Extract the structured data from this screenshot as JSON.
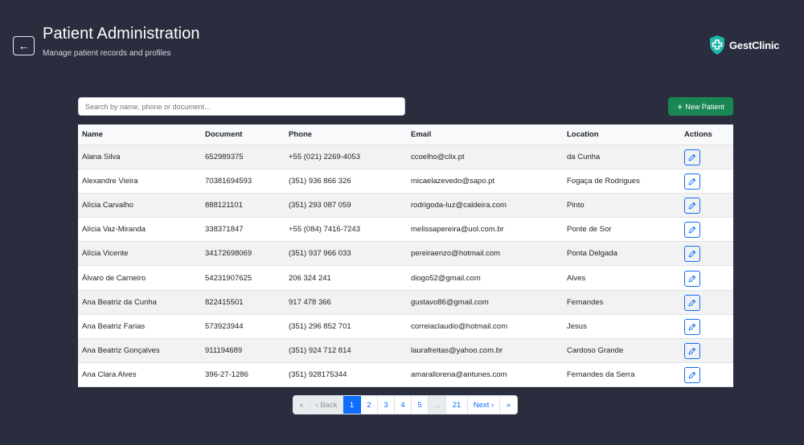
{
  "header": {
    "title": "Patient Administration",
    "subtitle": "Manage patient records and profiles",
    "back_icon": "←",
    "brand_name": "GestClinic"
  },
  "toolbar": {
    "search_placeholder": "Search by name, phone or document...",
    "new_patient_label": "New Patient",
    "new_patient_icon": "+"
  },
  "table": {
    "columns": [
      "Name",
      "Document",
      "Phone",
      "Email",
      "Location",
      "Actions"
    ],
    "rows": [
      {
        "name": "Alana Silva",
        "document": "652989375",
        "phone": "+55 (021) 2269-4053",
        "email": "ccoelho@clix.pt",
        "location": "da Cunha"
      },
      {
        "name": "Alexandre Vieira",
        "document": "70381694593",
        "phone": "(351) 936 866 326",
        "email": "micaelazevedo@sapo.pt",
        "location": "Fogaça de Rodrigues"
      },
      {
        "name": "Alícia Carvalho",
        "document": "888121101",
        "phone": "(351) 293 087 059",
        "email": "rodrigoda-luz@caldeira.com",
        "location": "Pinto"
      },
      {
        "name": "Alícia Vaz-Miranda",
        "document": "338371847",
        "phone": "+55 (084) 7416-7243",
        "email": "melissapereira@uol.com.br",
        "location": "Ponte de Sor"
      },
      {
        "name": "Alícia Vicente",
        "document": "34172698069",
        "phone": "(351) 937 966 033",
        "email": "pereiraenzo@hotmail.com",
        "location": "Ponta Delgada"
      },
      {
        "name": "Álvaro de Carneiro",
        "document": "54231907625",
        "phone": "206 324 241",
        "email": "diogo52@gmail.com",
        "location": "Alves"
      },
      {
        "name": "Ana Beatriz da Cunha",
        "document": "822415501",
        "phone": "917 478 366",
        "email": "gustavo86@gmail.com",
        "location": "Fernandes"
      },
      {
        "name": "Ana Beatriz Farias",
        "document": "573923944",
        "phone": "(351) 296 852 701",
        "email": "correiaclaudio@hotmail.com",
        "location": "Jesus"
      },
      {
        "name": "Ana Beatriz Gonçalves",
        "document": "911194689",
        "phone": "(351) 924 712 814",
        "email": "laurafreitas@yahoo.com.br",
        "location": "Cardoso Grande"
      },
      {
        "name": "Ana Clara Alves",
        "document": "396-27-1286",
        "phone": "(351) 928175344",
        "email": "amarallorena@antunes.com",
        "location": "Fernandes da Serra"
      }
    ]
  },
  "pagination": {
    "first": "«",
    "back": "‹ Back",
    "pages": [
      "1",
      "2",
      "3",
      "4",
      "5"
    ],
    "active_page": "1",
    "ellipsis": "...",
    "last_page": "21",
    "next": "Next ›",
    "last": "»"
  },
  "colors": {
    "background": "#292d3d",
    "primary": "#0d6efd",
    "success": "#198754",
    "brand": "#1fb5a8"
  }
}
